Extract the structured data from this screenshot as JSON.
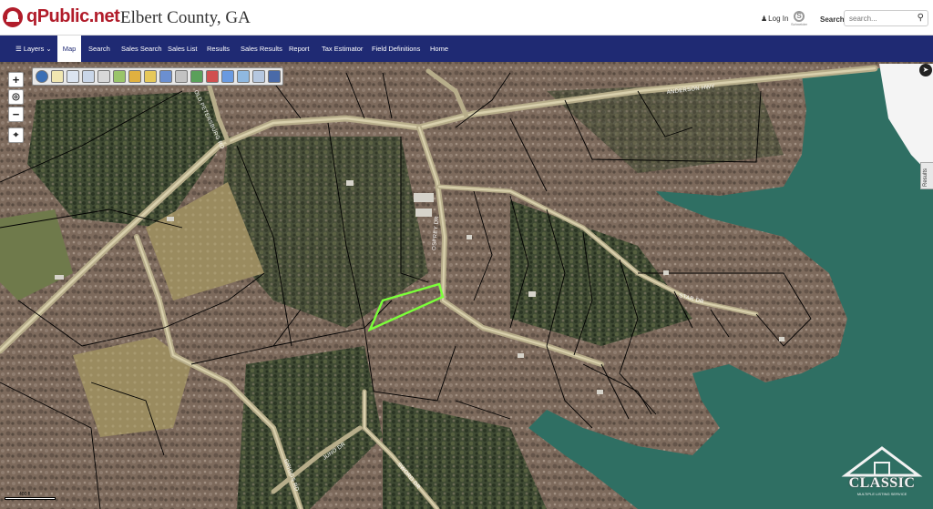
{
  "header": {
    "logo_text": "qPublic.net",
    "county": "Elbert County, GA",
    "login_label": "Log In",
    "search_label": "Search",
    "search_placeholder": "search..."
  },
  "nav": {
    "items": [
      "Layers",
      "Map",
      "Search",
      "Sales Search",
      "Sales List",
      "Results",
      "Sales Results",
      "Report",
      "Tax Estimator",
      "Field Definitions",
      "Home"
    ],
    "active": "Map"
  },
  "map": {
    "road_labels": [
      "ANDERSON HWY",
      "STAR DR",
      "OSPREY DR",
      "JUNO DR",
      "SWORD DR",
      "GRIGGS RD",
      "OLD PETERSBURG RD"
    ],
    "scale_label": "400 ft",
    "results_tab": "Results",
    "zoom_in": "+",
    "zoom_out": "−",
    "highlight_color": "#7cff3a",
    "water_color": "#2f6f63"
  },
  "watermark": {
    "text": "CLASSIC",
    "subtext": "MULTIPLE LISTING SERVICE"
  }
}
